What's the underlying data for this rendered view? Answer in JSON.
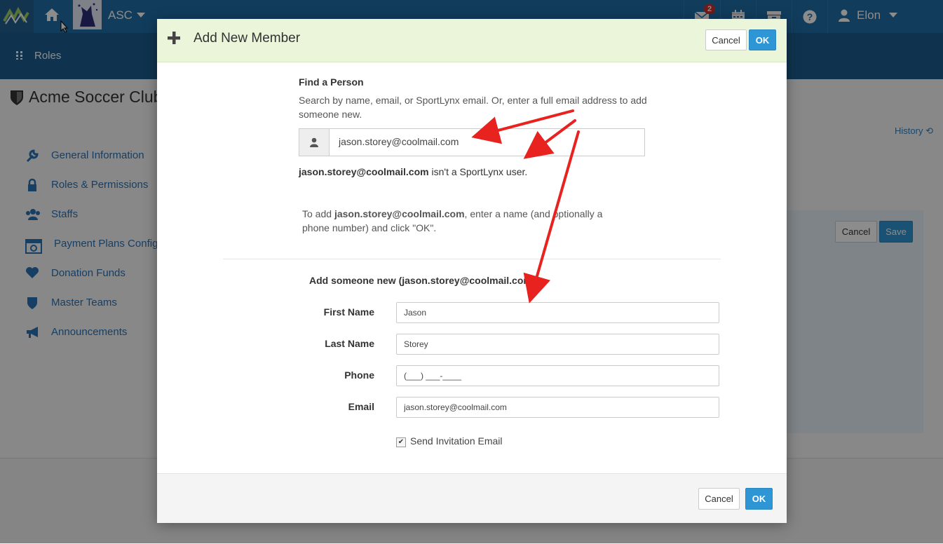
{
  "topbar": {
    "club_abbr": "ASC",
    "mail_badge": "2",
    "user_name": "Elon",
    "icons": [
      "logo-icon",
      "home-icon",
      "envelope-icon",
      "calendar-icon",
      "archive-icon",
      "help-icon",
      "user-icon"
    ]
  },
  "subbar": {
    "section": "Roles"
  },
  "page": {
    "title": "Acme Soccer Club",
    "history_label": "History",
    "cancel_label": "Cancel",
    "save_label": "Save",
    "nav": [
      {
        "label": "General Information",
        "icon": "wrench-icon"
      },
      {
        "label": "Roles & Permissions",
        "icon": "lock-icon"
      },
      {
        "label": "Staffs",
        "icon": "users-icon"
      },
      {
        "label": "Payment Plans Configu",
        "icon": "calendar-cog-icon"
      },
      {
        "label": "Donation Funds",
        "icon": "heart-icon"
      },
      {
        "label": "Master Teams",
        "icon": "shield-icon"
      },
      {
        "label": "Announcements",
        "icon": "megaphone-icon"
      }
    ]
  },
  "modal": {
    "title": "Add New Member",
    "cancel_label": "Cancel",
    "ok_label": "OK",
    "find_heading": "Find a Person",
    "find_help": "Search by name, email, or SportLynx email. Or, enter a full email address to add someone new.",
    "search_value": "jason.storey@coolmail.com",
    "not_user_email": "jason.storey@coolmail.com",
    "not_user_text": " isn't a SportLynx user.",
    "to_add_prefix": "To add ",
    "to_add_email": "jason.storey@coolmail.com",
    "to_add_suffix": ", enter a name (and optionally a phone number) and click \"OK\".",
    "add_new_heading": "Add someone new (jason.storey@coolmail.com)",
    "fields": {
      "first_name_label": "First Name",
      "first_name_value": "Jason",
      "last_name_label": "Last Name",
      "last_name_value": "Storey",
      "phone_label": "Phone",
      "phone_value": "(___) ___-____",
      "email_label": "Email",
      "email_value": "jason.storey@coolmail.com"
    },
    "send_invite_label": "Send Invitation Email",
    "send_invite_checked": true
  },
  "colors": {
    "topbar": "#1f6ea8",
    "primary_button": "#2f96d6",
    "modal_header": "#eaf5d9",
    "link": "#2b73b7",
    "annotation_arrow": "#e8231f"
  }
}
